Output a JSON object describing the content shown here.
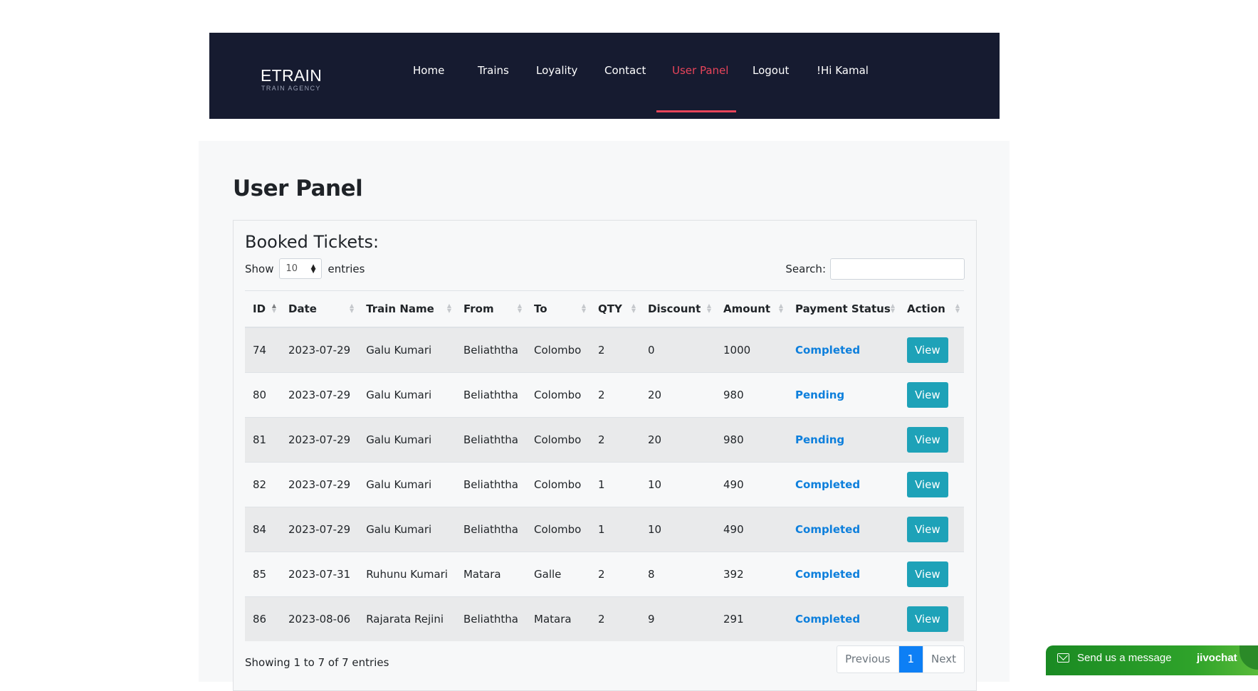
{
  "brand": {
    "name": "ETRAIN",
    "tagline": "TRAIN AGENCY"
  },
  "nav": [
    {
      "label": "Home",
      "name": "nav-home"
    },
    {
      "label": "Trains",
      "name": "nav-trains"
    },
    {
      "label": "Loyality",
      "name": "nav-loyality"
    },
    {
      "label": "Contact",
      "name": "nav-contact"
    },
    {
      "label": "User Panel",
      "name": "nav-user-panel",
      "active": true
    },
    {
      "label": "Logout",
      "name": "nav-logout"
    },
    {
      "label": "!Hi Kamal",
      "name": "nav-user-greeting"
    }
  ],
  "page": {
    "title": "User Panel"
  },
  "tickets_card": {
    "title": "Booked Tickets:",
    "show_label": "Show",
    "entries_label": "entries",
    "page_length": "10",
    "search_label": "Search:",
    "search_value": ""
  },
  "table": {
    "columns": [
      "ID",
      "Date",
      "Train Name",
      "From",
      "To",
      "QTY",
      "Discount",
      "Amount",
      "Payment Status",
      "Action"
    ],
    "rows": [
      {
        "id": "74",
        "date": "2023-07-29",
        "train": "Galu Kumari",
        "from": "Beliaththa",
        "to": "Colombo",
        "qty": "2",
        "discount": "0",
        "amount": "1000",
        "status": "Completed",
        "action": "View"
      },
      {
        "id": "80",
        "date": "2023-07-29",
        "train": "Galu Kumari",
        "from": "Beliaththa",
        "to": "Colombo",
        "qty": "2",
        "discount": "20",
        "amount": "980",
        "status": "Pending",
        "action": "View"
      },
      {
        "id": "81",
        "date": "2023-07-29",
        "train": "Galu Kumari",
        "from": "Beliaththa",
        "to": "Colombo",
        "qty": "2",
        "discount": "20",
        "amount": "980",
        "status": "Pending",
        "action": "View"
      },
      {
        "id": "82",
        "date": "2023-07-29",
        "train": "Galu Kumari",
        "from": "Beliaththa",
        "to": "Colombo",
        "qty": "1",
        "discount": "10",
        "amount": "490",
        "status": "Completed",
        "action": "View"
      },
      {
        "id": "84",
        "date": "2023-07-29",
        "train": "Galu Kumari",
        "from": "Beliaththa",
        "to": "Colombo",
        "qty": "1",
        "discount": "10",
        "amount": "490",
        "status": "Completed",
        "action": "View"
      },
      {
        "id": "85",
        "date": "2023-07-31",
        "train": "Ruhunu Kumari",
        "from": "Matara",
        "to": "Galle",
        "qty": "2",
        "discount": "8",
        "amount": "392",
        "status": "Completed",
        "action": "View"
      },
      {
        "id": "86",
        "date": "2023-08-06",
        "train": "Rajarata Rejini",
        "from": "Beliaththa",
        "to": "Matara",
        "qty": "2",
        "discount": "9",
        "amount": "291",
        "status": "Completed",
        "action": "View"
      }
    ]
  },
  "pagination": {
    "info": "Showing 1 to 7 of 7 entries",
    "previous": "Previous",
    "current_page": "1",
    "next": "Next"
  },
  "chat_widget": {
    "label": "Send us a message",
    "brand": "jivochat"
  },
  "colors": {
    "nav_bg": "#161b30",
    "accent": "#e8445a",
    "status_link": "#0d7fdc",
    "view_button": "#1ea2b8",
    "chat": "#2fa32a"
  }
}
